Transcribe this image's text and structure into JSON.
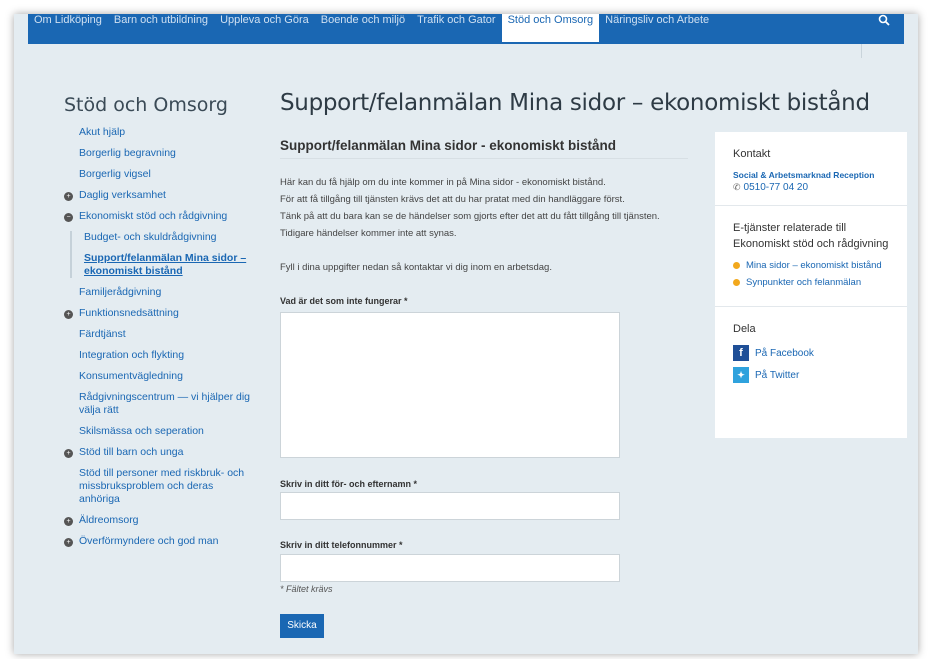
{
  "topnav": {
    "items": [
      {
        "label": "Om Lidköping"
      },
      {
        "label": "Barn och utbildning"
      },
      {
        "label": "Uppleva och Göra"
      },
      {
        "label": "Boende och miljö"
      },
      {
        "label": "Trafik och Gator"
      },
      {
        "label": "Stöd och Omsorg",
        "active": true
      },
      {
        "label": "Näringsliv och Arbete"
      }
    ],
    "search_icon": "search-icon"
  },
  "sidebar": {
    "title": "Stöd och Omsorg",
    "items": [
      {
        "label": "Akut hjälp"
      },
      {
        "label": "Borgerlig begravning"
      },
      {
        "label": "Borgerlig vigsel"
      },
      {
        "label": "Daglig verksamhet",
        "bullet": "+"
      },
      {
        "label": "Ekonomiskt stöd och rådgivning",
        "bullet": "−"
      },
      {
        "label": "Budget- och skuldrådgivning"
      },
      {
        "label": "Support/felanmälan Mina sidor – ekonomiskt bistånd"
      },
      {
        "label": "Familjerådgivning"
      },
      {
        "label": "Funktionsnedsättning",
        "bullet": "+"
      },
      {
        "label": "Färdtjänst"
      },
      {
        "label": "Integration och flykting"
      },
      {
        "label": "Konsumentvägledning"
      },
      {
        "label": "Rådgivningscentrum — vi hjälper dig välja rätt"
      },
      {
        "label": "Skilsmässa och seperation"
      },
      {
        "label": "Stöd till barn och unga",
        "bullet": "+"
      },
      {
        "label": "Stöd till personer med riskbruk- och missbruksproblem och deras anhöriga"
      },
      {
        "label": "Äldreomsorg",
        "bullet": "+"
      },
      {
        "label": "Överförmyndere och god man",
        "bullet": "+"
      }
    ]
  },
  "main": {
    "title": "Support/felanmälan Mina sidor – ekonomiskt bistånd",
    "form_heading": "Support/felanmälan Mina sidor - ekonomiskt bistånd",
    "intro": [
      "Här kan du få hjälp om du inte kommer in på Mina sidor - ekonomiskt bistånd.",
      "För att få tillgång till tjänsten krävs det att du har pratat med din handläggare först.",
      "Tänk på att du bara kan se de händelser som gjorts efter det att du fått tillgång till tjänsten.",
      "Tidigare händelser kommer inte att synas."
    ],
    "intro2": "Fyll i dina uppgifter nedan så kontaktar vi dig inom en arbetsdag.",
    "field1_label": "Vad är det som inte fungerar *",
    "field2_label": "Skriv in ditt för- och efternamn *",
    "field3_label": "Skriv in ditt telefonnummer *",
    "required_note": "* Fältet krävs",
    "submit_label": "Skicka"
  },
  "aside": {
    "contact_title": "Kontakt",
    "contact_name": "Social & Arbetsmarknad Reception",
    "contact_phone": "0510-77 04 20",
    "eservices_title": "E-tjänster relaterade till Ekonomiskt stöd och rådgivning",
    "eservices": [
      {
        "label": "Mina sidor – ekonomiskt bistånd"
      },
      {
        "label": "Synpunkter och felanmälan"
      }
    ],
    "share_title": "Dela",
    "facebook_label": "På Facebook",
    "twitter_label": "På Twitter"
  },
  "colors": {
    "brand": "#1a67b3",
    "accent": "#f2a81d",
    "background": "#e4ecf1"
  }
}
